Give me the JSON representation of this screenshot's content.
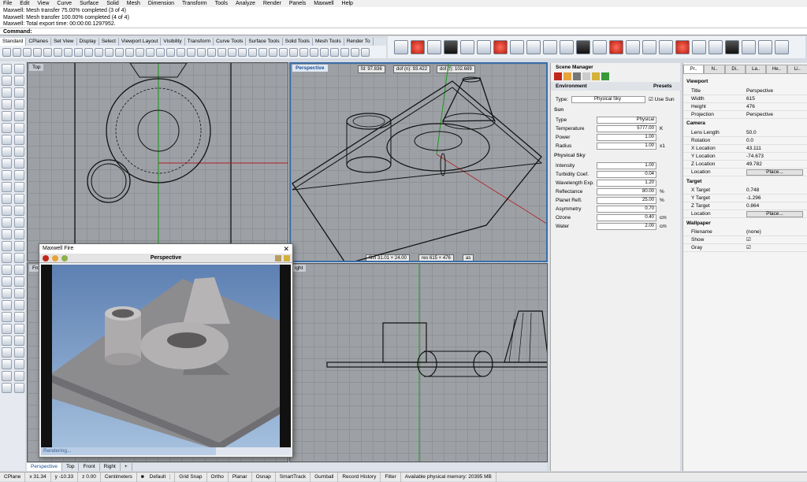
{
  "menu": [
    "File",
    "Edit",
    "View",
    "Curve",
    "Surface",
    "Solid",
    "Mesh",
    "Dimension",
    "Transform",
    "Tools",
    "Analyze",
    "Render",
    "Panels",
    "Maxwell",
    "Help"
  ],
  "history": [
    "Maxwell: Mesh transfer 75.00% completed (3 of 4)",
    "Maxwell: Mesh transfer 100.00% completed (4 of 4)",
    "Maxwell: Total export time: 00:00:00.1297952."
  ],
  "command_label": "Command:",
  "toolbar_tabs": [
    "Standard",
    "CPlanes",
    "Set View",
    "Display",
    "Select",
    "Viewport Layout",
    "Visibility",
    "Transform",
    "Curve Tools",
    "Surface Tools",
    "Solid Tools",
    "Mesh Tools",
    "Render To"
  ],
  "viewports": {
    "top": "Top",
    "perspective": "Perspective",
    "right": "Right",
    "front_partial": "Fro",
    "right_partial": "ight",
    "hud_fd": "fd: 97.836",
    "hud_dofn": "dof (n): 93.422",
    "hud_doff": "dof (f): 102.689",
    "hud_film": "film 31.01 × 24.00",
    "hud_res": "res 615 × 476",
    "hud_as": "as"
  },
  "maxwell": {
    "title": "Maxwell Fire",
    "view": "Perspective",
    "status": "Rendering...",
    "progress_fraction": 0.7
  },
  "scene": {
    "title": "Scene Manager",
    "section": "Environment",
    "presets": "Presets",
    "type_label": "Type:",
    "type_value": "Physical Sky",
    "use_sun": "Use Sun",
    "sun_header": "Sun",
    "sun": [
      {
        "label": "Type",
        "value": "Physical",
        "unit": ""
      },
      {
        "label": "Temperature",
        "value": "5777.00",
        "unit": "K"
      },
      {
        "label": "Power",
        "value": "1.00",
        "unit": ""
      },
      {
        "label": "Radius",
        "value": "1.00",
        "unit": "x1"
      }
    ],
    "sky_header": "Physical Sky",
    "sky": [
      {
        "label": "Intensity",
        "value": "1.00",
        "unit": ""
      },
      {
        "label": "Turbidity Coef.",
        "value": "0.04",
        "unit": ""
      },
      {
        "label": "Wavelength Exp.",
        "value": "1.20",
        "unit": ""
      },
      {
        "label": "Reflectance",
        "value": "80.00",
        "unit": "%"
      },
      {
        "label": "Planet Refl.",
        "value": "25.00",
        "unit": "%"
      },
      {
        "label": "Asymmetry",
        "value": "0.70",
        "unit": ""
      },
      {
        "label": "Ozone",
        "value": "0.40",
        "unit": "cm"
      },
      {
        "label": "Water",
        "value": "2.00",
        "unit": "cm"
      }
    ]
  },
  "props": {
    "tabs": [
      "Pr..",
      "N..",
      "Di..",
      "La..",
      "He..",
      "Li.."
    ],
    "viewport_header": "Viewport",
    "viewport": [
      {
        "k": "Title",
        "v": "Perspective"
      },
      {
        "k": "Width",
        "v": "615"
      },
      {
        "k": "Height",
        "v": "476"
      },
      {
        "k": "Projection",
        "v": "Perspective"
      }
    ],
    "camera_header": "Camera",
    "camera": [
      {
        "k": "Lens Length",
        "v": "50.0"
      },
      {
        "k": "Rotation",
        "v": "0.0"
      },
      {
        "k": "X Location",
        "v": "43.111"
      },
      {
        "k": "Y Location",
        "v": "-74.673"
      },
      {
        "k": "Z Location",
        "v": "49.782"
      }
    ],
    "location_label": "Location",
    "place_button": "Place...",
    "target_header": "Target",
    "target": [
      {
        "k": "X Target",
        "v": "0.748"
      },
      {
        "k": "Y Target",
        "v": "-1.296"
      },
      {
        "k": "Z Target",
        "v": "0.864"
      }
    ],
    "wallpaper_header": "Wallpaper",
    "filename_label": "Filename",
    "filename_value": "(none)",
    "show_label": "Show",
    "gray_label": "Gray"
  },
  "viewport_tabs": [
    "Perspective",
    "Top",
    "Front",
    "Right"
  ],
  "status": {
    "cplane": "CPlane",
    "x": "x 31.34",
    "y": "y -10.33",
    "z": "z 0.00",
    "units": "Centimeters",
    "layer": "Default",
    "items": [
      "Grid Snap",
      "Ortho",
      "Planar",
      "Osnap",
      "SmartTrack",
      "Gumball",
      "Record History",
      "Filter"
    ],
    "memory": "Available physical memory: 20395 MB"
  }
}
